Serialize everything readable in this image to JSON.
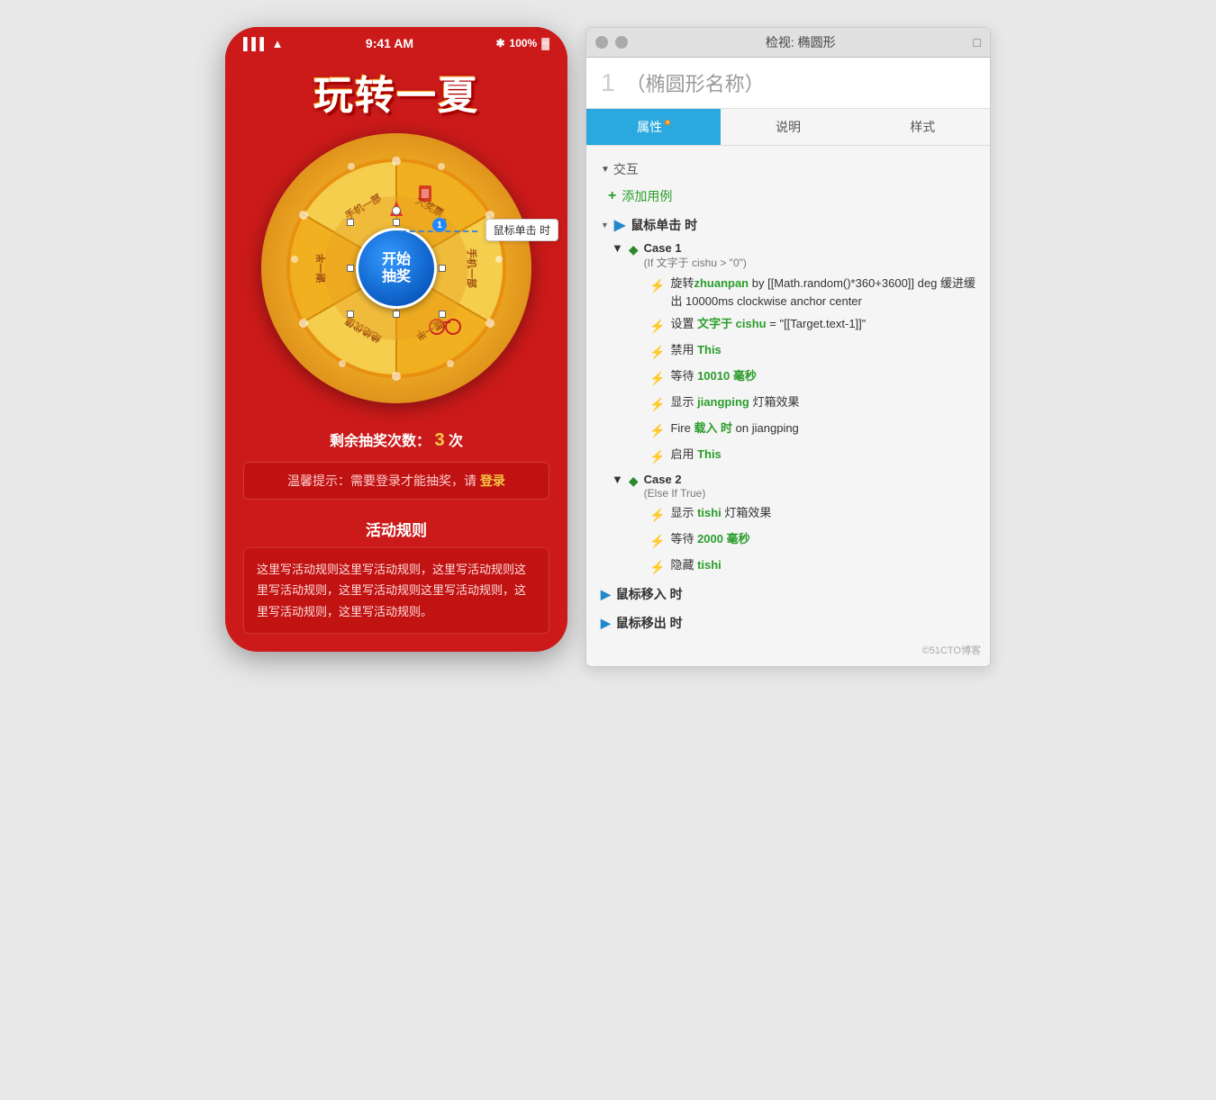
{
  "phone": {
    "status_bar": {
      "signal": "▌▌▌",
      "wifi": "wifi",
      "time": "9:41 AM",
      "bluetooth": "✱",
      "battery": "100%"
    },
    "title": "玩转一夏",
    "wheel_btn_line1": "开始",
    "wheel_btn_line2": "抽奖",
    "mouse_click_label": "鼠标单击 时",
    "remaining_label": "剩余抽奖次数：",
    "remaining_count": "3",
    "remaining_unit": "次",
    "warning_text": "温馨提示：需要登录才能抽奖，请",
    "login_link": "登录",
    "rules_title": "活动规则",
    "rules_text": "这里写活动规则这里写活动规则，这里写活动规则这里写活动规则，这里写活动规则这里写活动规则，这里写活动规则，这里写活动规则。"
  },
  "inspector": {
    "title": "检视: 椭圆形",
    "element_number": "1",
    "element_name": "（椭圆形名称）",
    "tabs": [
      {
        "label": "属性",
        "modified": true,
        "active": true
      },
      {
        "label": "说明",
        "modified": false,
        "active": false
      },
      {
        "label": "样式",
        "modified": false,
        "active": false
      }
    ],
    "interaction_section": "交互",
    "add_usecase": "添加用例",
    "mouse_click_root": "鼠标单击 时",
    "case1": {
      "label": "Case 1",
      "condition": "(If 文字于 cishu > \"0\")",
      "actions": [
        {
          "text_before": "旋转",
          "highlight": "zhuanpan",
          "text_after": " by [[Math.random()*360+3600]] deg 缓进缓出 10000ms clockwise anchor center"
        },
        {
          "text_before": "设置 ",
          "highlight": "文字于 cishu",
          "text_after": " = \"[[Target.text-1]]\""
        },
        {
          "text_before": "禁用 ",
          "highlight": "This",
          "text_after": ""
        },
        {
          "text_before": "等待 ",
          "highlight": "10010 毫秒",
          "text_after": ""
        },
        {
          "text_before": "显示 ",
          "highlight": "jiangping",
          "text_after": " 灯箱效果"
        },
        {
          "text_before": "Fire ",
          "highlight": "载入 时",
          "text_after": " on jiangping"
        },
        {
          "text_before": "启用 ",
          "highlight": "This",
          "text_after": ""
        }
      ]
    },
    "case2": {
      "label": "Case 2",
      "condition": "(Else If True)",
      "actions": [
        {
          "text_before": "显示 ",
          "highlight": "tishi",
          "text_after": " 灯箱效果"
        },
        {
          "text_before": "等待 ",
          "highlight": "2000 毫秒",
          "text_after": ""
        },
        {
          "text_before": "隐藏 ",
          "highlight": "tishi",
          "text_after": ""
        }
      ]
    },
    "mouse_hover": "鼠标移入 时",
    "mouse_out": "鼠标移出 时"
  },
  "watermark": "©51CTO博客"
}
